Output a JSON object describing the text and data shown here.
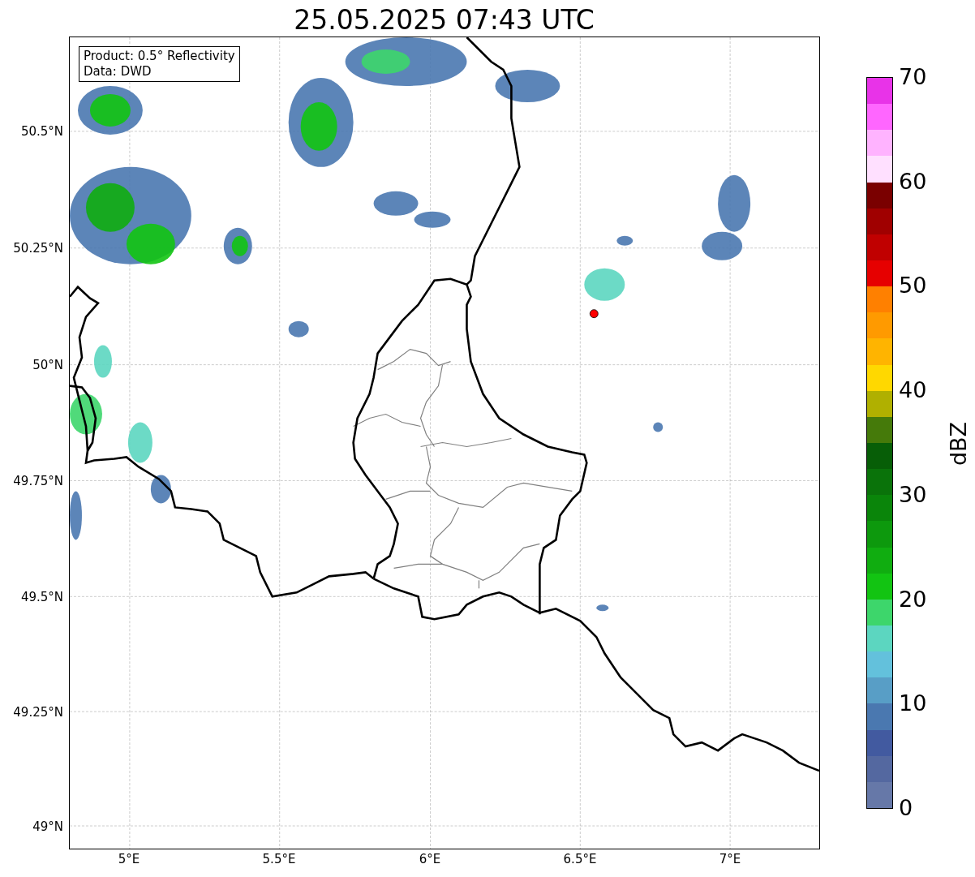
{
  "title": "25.05.2025 07:43 UTC",
  "info_box": {
    "lines": [
      "Product: 0.5° Reflectivity",
      "Data: DWD"
    ]
  },
  "y_ticks": [
    "50.5°N",
    "50.25°N",
    "50°N",
    "49.75°N",
    "49.5°N",
    "49.25°N",
    "49°N"
  ],
  "x_ticks": [
    "5°E",
    "5.5°E",
    "6°E",
    "6.5°E",
    "7°E"
  ],
  "colorbar": {
    "label": "dBZ",
    "ticks": [
      "70",
      "60",
      "50",
      "40",
      "30",
      "20",
      "10",
      "0"
    ]
  }
}
